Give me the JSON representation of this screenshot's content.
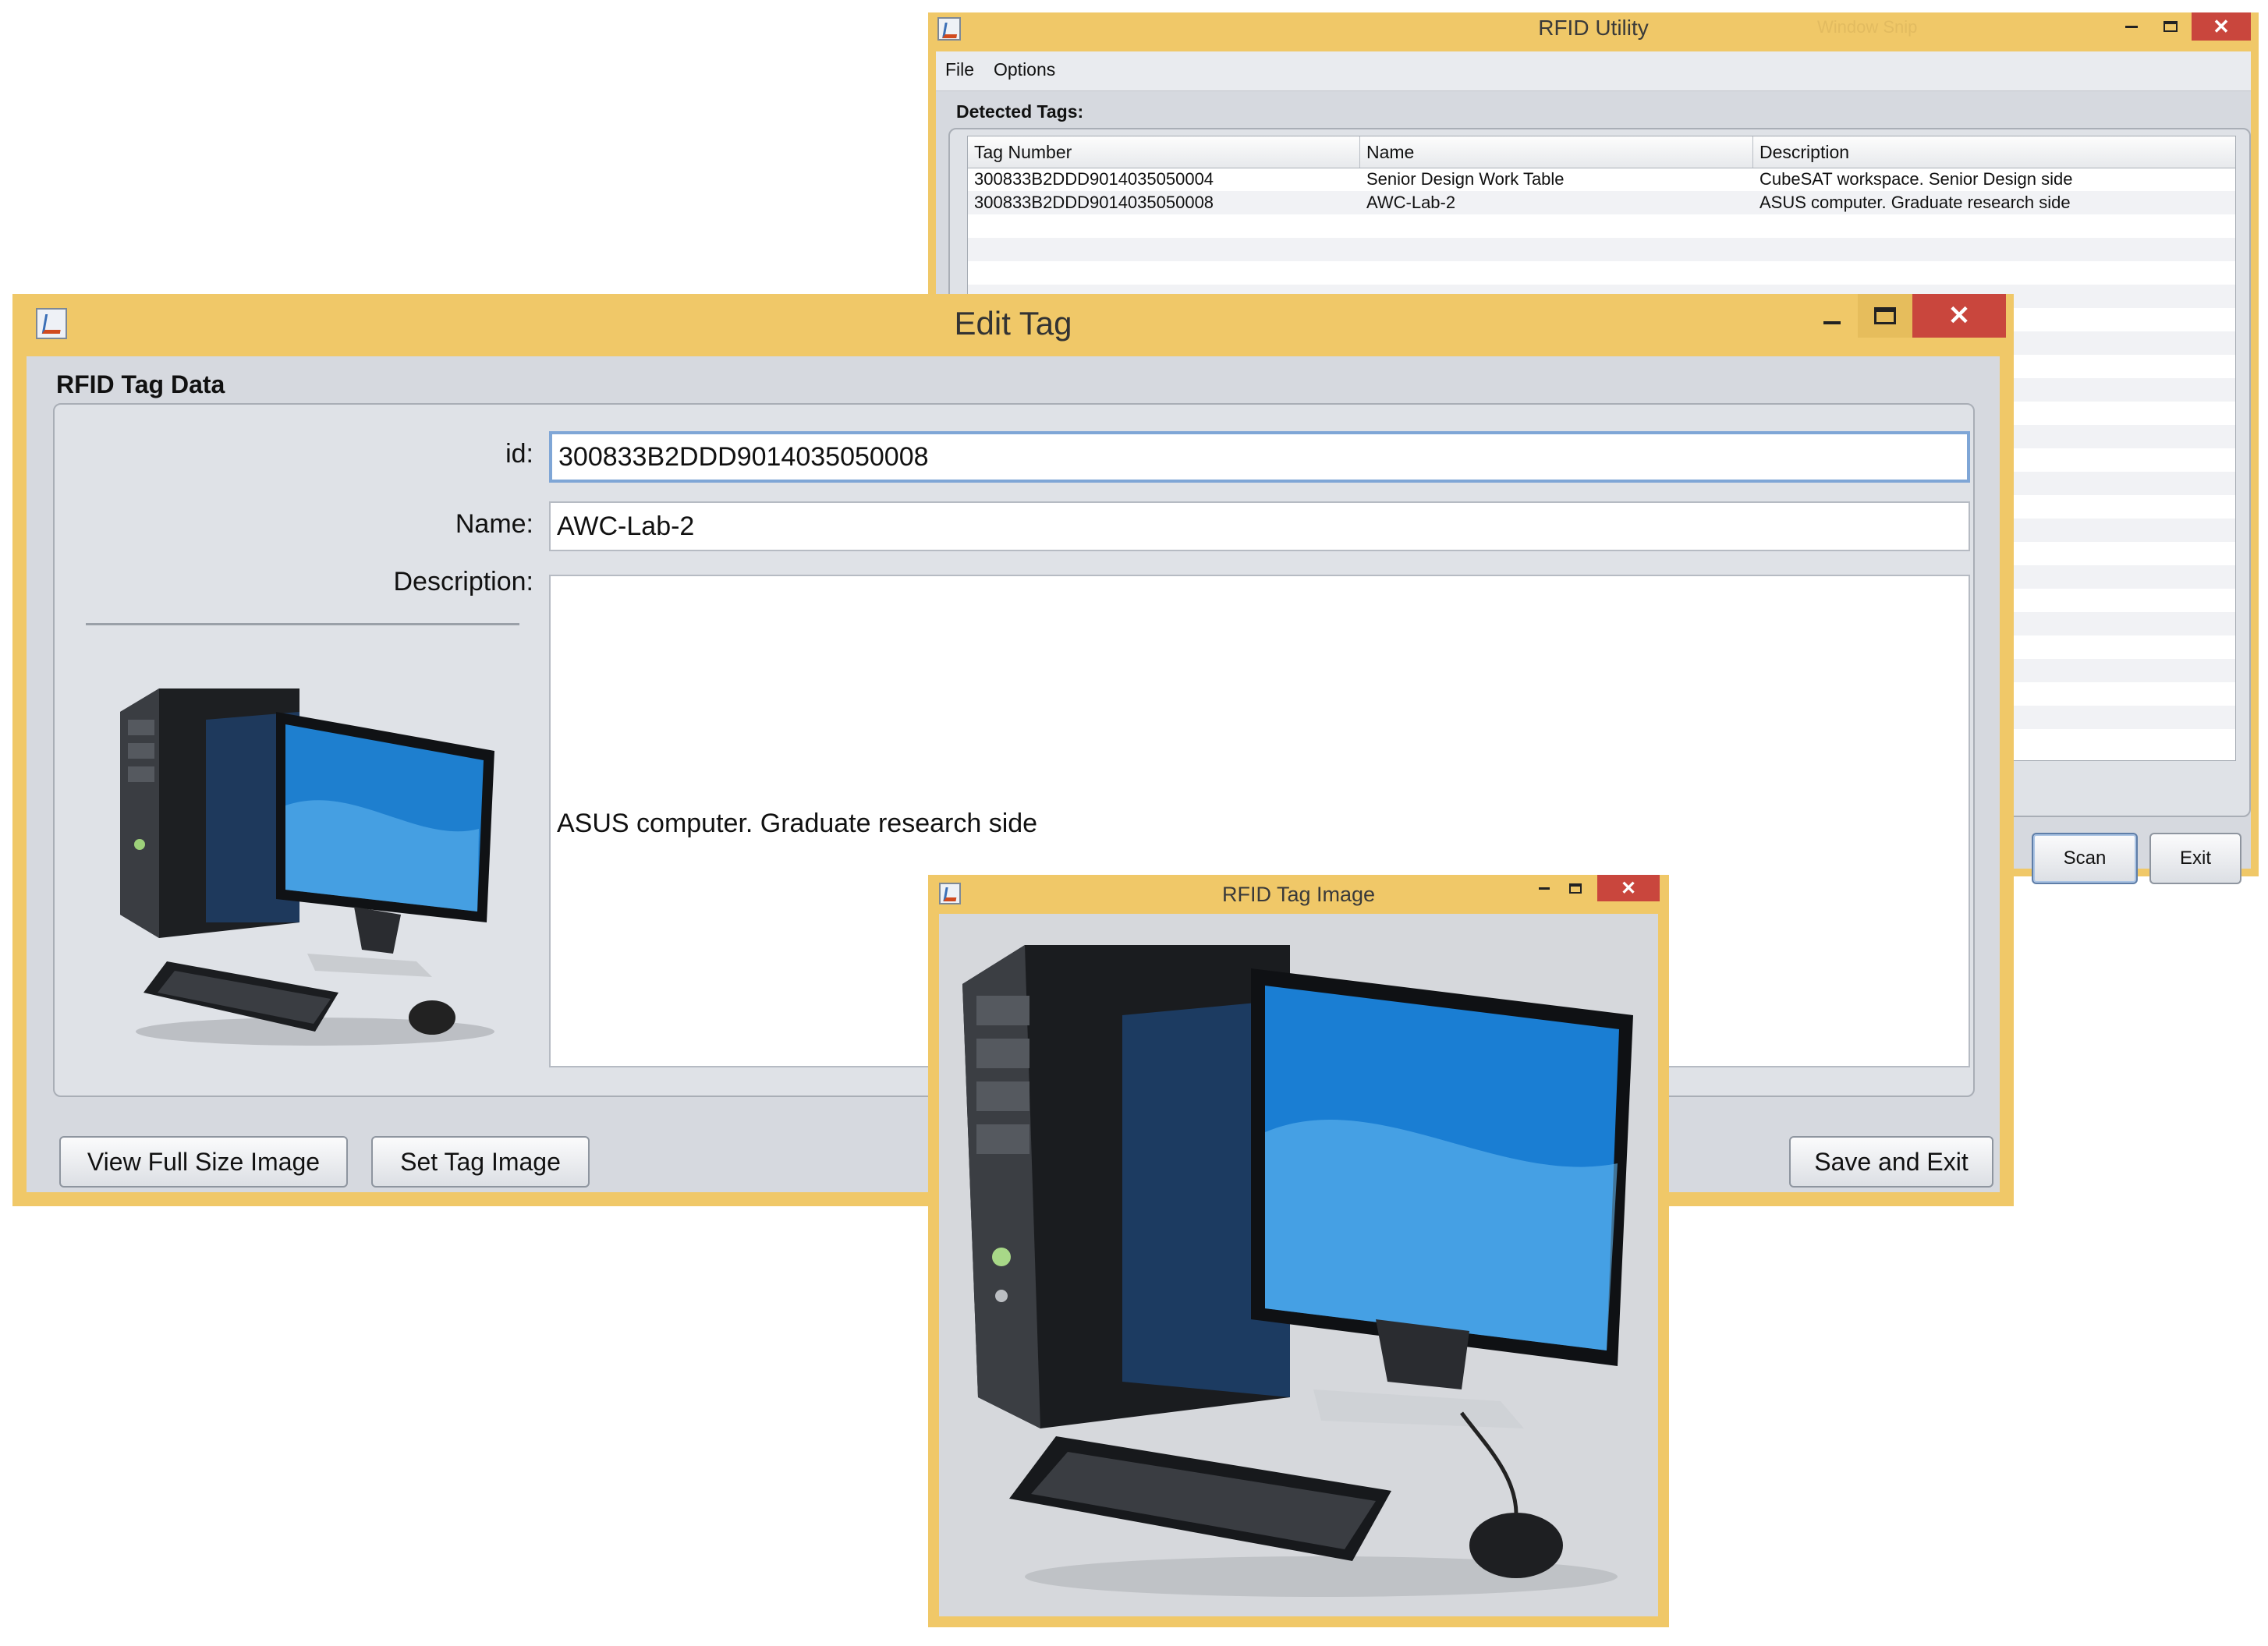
{
  "rfid_utility": {
    "title": "RFID Utility",
    "taskbar_hint": "Window Snip",
    "menu": [
      "File",
      "Options"
    ],
    "section_label": "Detected Tags:",
    "columns": [
      "Tag Number",
      "Name",
      "Description"
    ],
    "rows": [
      [
        "300833B2DDD9014035050004",
        "Senior Design Work Table",
        "CubeSAT workspace. Senior Design side"
      ],
      [
        "300833B2DDD9014035050008",
        "AWC-Lab-2",
        "ASUS computer. Graduate research side"
      ]
    ],
    "buttons": {
      "scan": "Scan",
      "exit": "Exit"
    }
  },
  "edit_tag": {
    "title": "Edit Tag",
    "group_label": "RFID Tag Data",
    "labels": {
      "id": "id:",
      "name": "Name:",
      "description": "Description:"
    },
    "values": {
      "id": "300833B2DDD9014035050008",
      "name": "AWC-Lab-2",
      "description": "ASUS computer. Graduate research side"
    },
    "thumbnail_icon": "desktop-computer-icon",
    "buttons": {
      "view_full": "View Full Size Image",
      "set_image": "Set Tag Image",
      "save_exit": "Save and Exit"
    }
  },
  "tag_image_window": {
    "title": "RFID Tag Image",
    "image_icon": "desktop-computer-icon"
  },
  "colors": {
    "title_bar": "#f0c868",
    "close_button": "#c9463d",
    "client_bg": "#d6d9df",
    "focus_border": "#7fa6d6"
  }
}
